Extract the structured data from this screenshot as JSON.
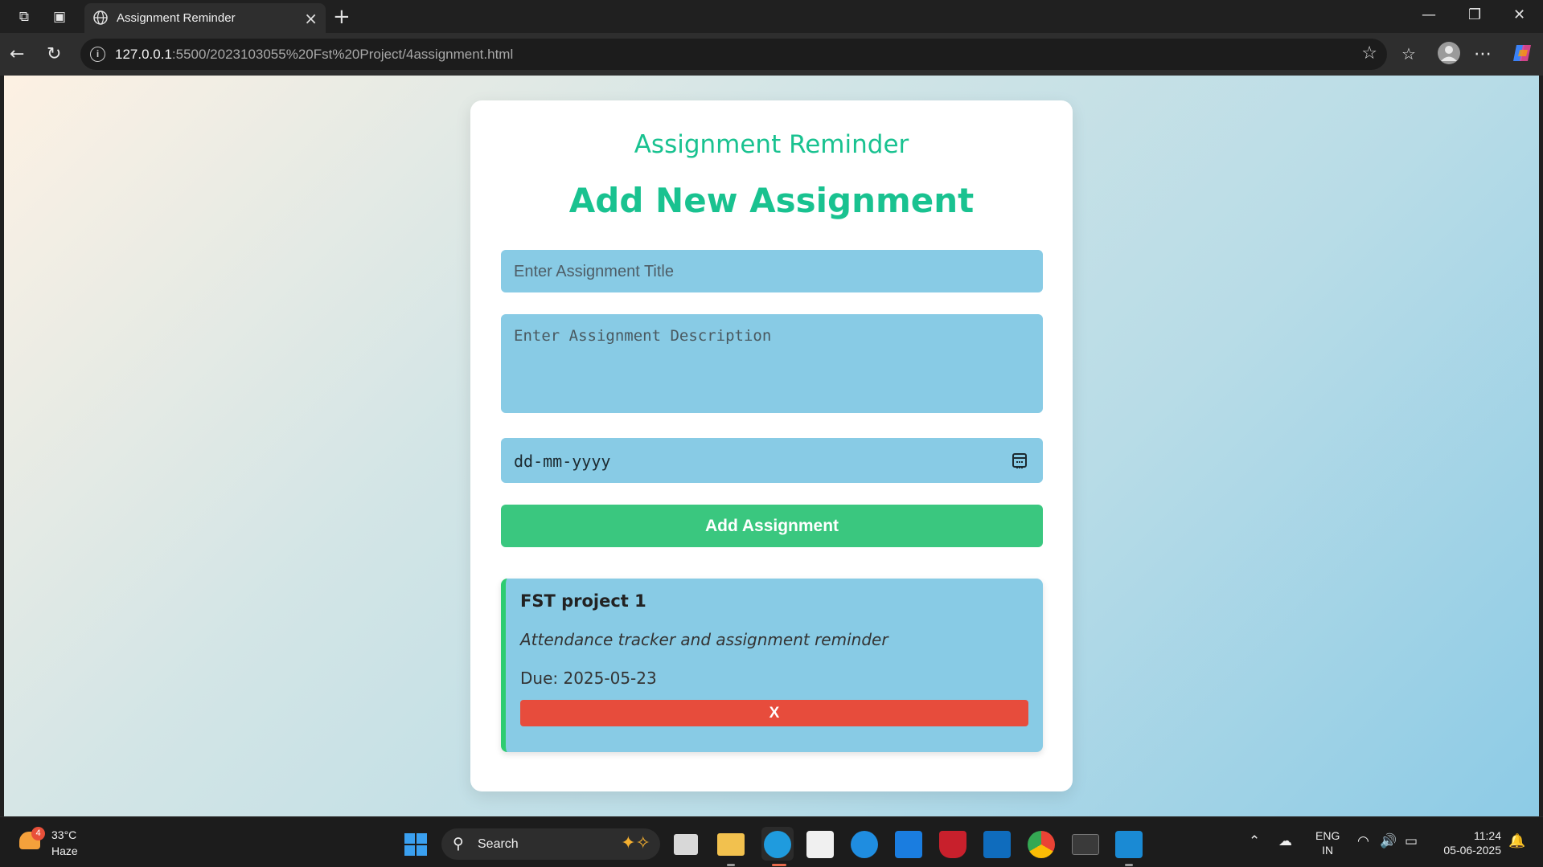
{
  "browser": {
    "tab_title": "Assignment Reminder",
    "url_host": "127.0.0.1",
    "url_rest": ":5500/2023103055%20Fst%20Project/4assignment.html"
  },
  "page": {
    "app_title": "Assignment Reminder",
    "heading": "Add New Assignment",
    "title_placeholder": "Enter Assignment Title",
    "description_placeholder": "Enter Assignment Description",
    "date_placeholder": "dd-mm-yyyy",
    "add_button": "Add Assignment",
    "assignments": [
      {
        "title": "FST project 1",
        "description": "Attendance tracker and assignment reminder",
        "due": "Due: 2025-05-23",
        "delete_label": "X"
      }
    ]
  },
  "taskbar": {
    "weather_badge": "4",
    "weather_temp": "33°C",
    "weather_desc": "Haze",
    "search_label": "Search",
    "lang_line1": "ENG",
    "lang_line2": "IN",
    "time": "11:24",
    "date": "05-06-2025"
  },
  "colors": {
    "accent_green": "#19c290",
    "add_button": "#3ac77f",
    "input_bg": "#88cbe5",
    "delete_button": "#e74c3c"
  }
}
